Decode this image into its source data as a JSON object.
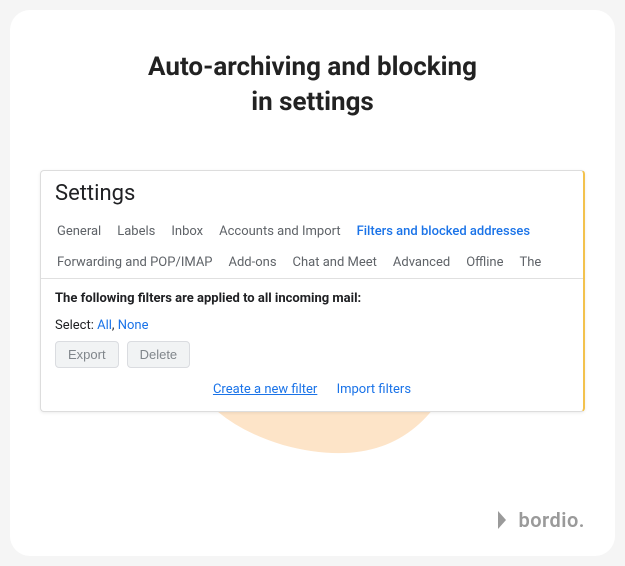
{
  "title_line1": "Auto-archiving and blocking",
  "title_line2": "in settings",
  "settings": {
    "header": "Settings",
    "tabs": {
      "general": "General",
      "labels": "Labels",
      "inbox": "Inbox",
      "accounts": "Accounts and Import",
      "filters": "Filters and blocked addresses",
      "forwarding": "Forwarding and POP/IMAP",
      "addons": "Add-ons",
      "chat": "Chat and Meet",
      "advanced": "Advanced",
      "offline": "Offline",
      "themes": "The"
    },
    "filter_heading": "The following filters are applied to all incoming mail:",
    "select_label": "Select:",
    "select_all": "All",
    "select_sep": ", ",
    "select_none": "None",
    "export_btn": "Export",
    "delete_btn": "Delete",
    "create_filter": "Create a new filter",
    "import_filters": "Import filters"
  },
  "brand": "bordio."
}
